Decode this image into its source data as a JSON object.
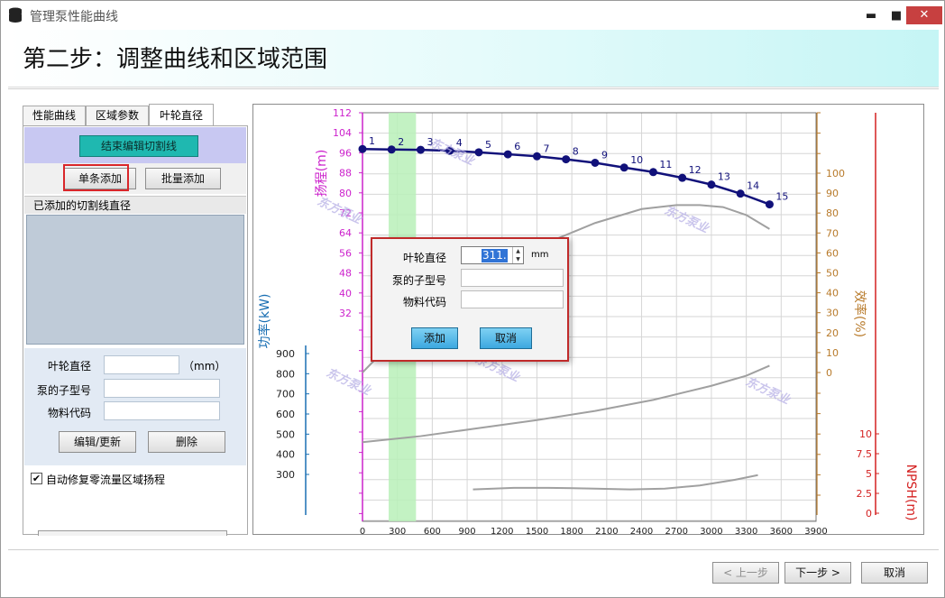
{
  "window": {
    "title": "管理泵性能曲线",
    "min_glyph": "▬",
    "max_glyph": "■",
    "close_glyph": "✕"
  },
  "header": {
    "step_title": "第二步：调整曲线和区域范围"
  },
  "tabs": [
    {
      "label": "性能曲线"
    },
    {
      "label": "区域参数"
    },
    {
      "label": "叶轮直径",
      "active": true
    }
  ],
  "left": {
    "end_edit_label": "结束编辑切割线",
    "single_add_label": "单条添加",
    "batch_add_label": "批量添加",
    "added_header": "已添加的切割线直径",
    "form": {
      "diameter_label": "叶轮直径",
      "diameter_unit": "（mm）",
      "submodel_label": "泵的子型号",
      "material_label": "物料代码"
    },
    "edit_label": "编辑/更新",
    "delete_label": "删除",
    "auto_fix_label": "自动修复零流量区域扬程",
    "auto_fix_checked": true
  },
  "dialog": {
    "diameter_label": "叶轮直径",
    "diameter_value": "311.",
    "unit": "mm",
    "submodel_label": "泵的子型号",
    "material_label": "物料代码",
    "add_label": "添加",
    "cancel_label": "取消"
  },
  "chart_data": {
    "type": "line",
    "x_ticks": [
      "0",
      "300",
      "600",
      "900",
      "1200",
      "1500",
      "1800",
      "2100",
      "2400",
      "2700",
      "3000",
      "3300",
      "3600",
      "3900"
    ],
    "xlim": [
      0,
      3900
    ],
    "head_axis": {
      "label": "扬程(m)",
      "ticks": [
        "32",
        "40",
        "48",
        "56",
        "64",
        "72",
        "80",
        "88",
        "96",
        "104",
        "112"
      ],
      "color": "#cc22cc"
    },
    "power_axis": {
      "label": "功率(kW)",
      "ticks": [
        "300",
        "400",
        "500",
        "600",
        "700",
        "800",
        "900"
      ],
      "color": "#1a6fb3"
    },
    "efficiency_axis": {
      "label": "效率(%)",
      "ticks": [
        "0",
        "10",
        "20",
        "30",
        "40",
        "50",
        "60",
        "70",
        "80",
        "90",
        "100"
      ],
      "color": "#b87a2a"
    },
    "npsh_axis": {
      "label": "NPSH(m)",
      "ticks": [
        "0",
        "2.5",
        "5",
        "7.5",
        "10"
      ],
      "color": "#d42020"
    },
    "head_points": {
      "labels": [
        "1",
        "2",
        "3",
        "4",
        "5",
        "6",
        "7",
        "8",
        "9",
        "10",
        "11",
        "12",
        "13",
        "14",
        "15"
      ],
      "x": [
        0,
        250,
        500,
        750,
        1000,
        1250,
        1500,
        1750,
        2000,
        2250,
        2500,
        2750,
        3000,
        3250,
        3500
      ],
      "y": [
        97.5,
        97.3,
        97.2,
        96.8,
        96.2,
        95.4,
        94.6,
        93.4,
        92.0,
        90.1,
        88.3,
        86.0,
        83.3,
        79.7,
        75.4
      ],
      "color": "#11117a"
    },
    "efficiency_curve": {
      "x": [
        0,
        500,
        1000,
        1500,
        2000,
        2400,
        2700,
        2900,
        3100,
        3300,
        3500
      ],
      "y": [
        0,
        30,
        50,
        63,
        75,
        82,
        84,
        84,
        83,
        79,
        72
      ]
    },
    "power_curve": {
      "x": [
        0,
        500,
        1000,
        1500,
        2000,
        2500,
        3000,
        3300,
        3500
      ],
      "y": [
        460,
        490,
        530,
        570,
        615,
        670,
        740,
        790,
        840
      ]
    },
    "npsh_curve": {
      "x": [
        950,
        1300,
        1600,
        2000,
        2300,
        2600,
        2900,
        3200,
        3400
      ],
      "y": [
        3.0,
        3.2,
        3.2,
        3.1,
        3.0,
        3.1,
        3.5,
        4.2,
        4.8
      ]
    },
    "highlight_band": {
      "x_from": 225,
      "x_to": 460,
      "color": "#b9f0b9"
    },
    "watermark": "东方泵业"
  },
  "footer": {
    "prev_label": "< 上一步",
    "next_label": "下一步 >",
    "cancel_label": "取消"
  }
}
